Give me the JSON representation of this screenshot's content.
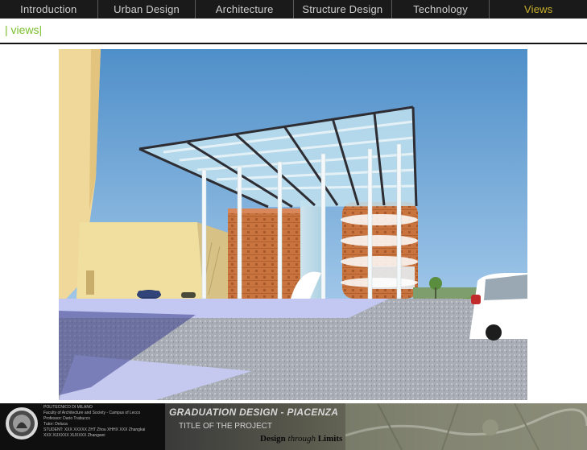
{
  "nav": {
    "tabs": [
      {
        "label": "Introduction"
      },
      {
        "label": "Urban Design"
      },
      {
        "label": "Architecture"
      },
      {
        "label": "Structure Design"
      },
      {
        "label": "Technology"
      },
      {
        "label": "Views"
      }
    ],
    "active_index": 5,
    "active_color": "#c8b02c",
    "inactive_color": "#cfcfcf"
  },
  "section": {
    "title": "| views|",
    "color": "#7bbf2e"
  },
  "footer": {
    "university": "POLITECNICO DI MILANO",
    "faculty": "Faculty of Architecture and Society - Campus of Lecco",
    "professor": "Professor: Dario Trabucco",
    "tutor": "Tutor: Deluca",
    "students": "STUDENT: XXX XXXXX  ZHT  Zhou   XHHX  XXX  Zhangkai",
    "students_2": "XXX XUXXXX  XUXXXX  Zhangwei",
    "graduation_title": "GRADUATION DESIGN - PIACENZA",
    "project_title": "TITLE OF THE PROJECT",
    "motto_part1": "Design",
    "motto_part2": "through",
    "motto_part3": "Limits"
  }
}
